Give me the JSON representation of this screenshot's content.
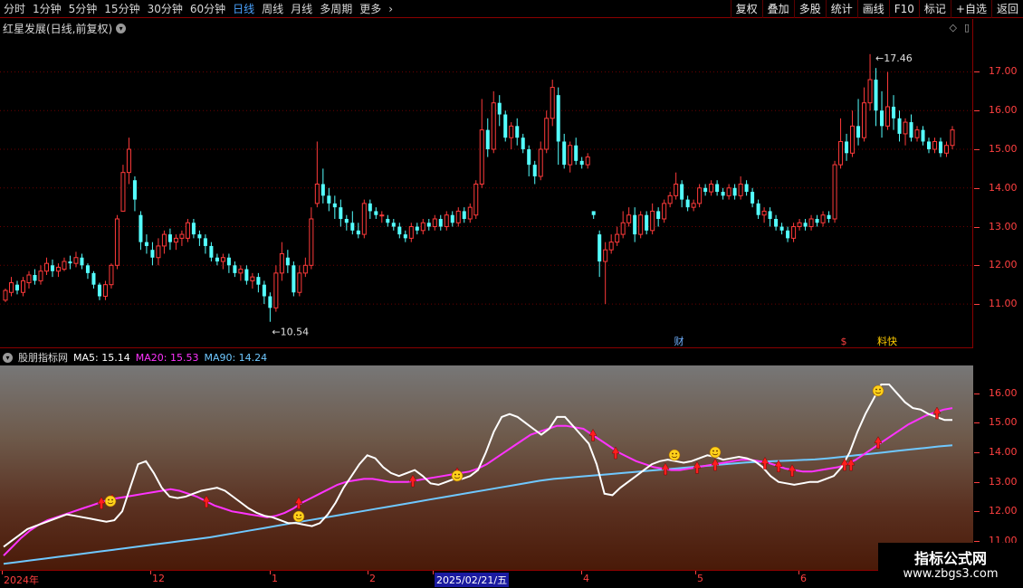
{
  "toolbar": {
    "periods": [
      "分时",
      "1分钟",
      "5分钟",
      "15分钟",
      "30分钟",
      "60分钟",
      "日线",
      "周线",
      "月线",
      "多周期",
      "更多"
    ],
    "active_period": "日线",
    "buttons": [
      "复权",
      "叠加",
      "多股",
      "统计",
      "画线",
      "F10",
      "标记",
      "+自选",
      "返回"
    ]
  },
  "main": {
    "title": "红星发展(日线,前复权)",
    "high_label": "17.46",
    "low_label": "10.54",
    "markers": [
      "财",
      "$",
      "料快"
    ],
    "ticks": [
      "17.00",
      "16.00",
      "15.00",
      "14.00",
      "13.00",
      "12.00",
      "11.00"
    ]
  },
  "indicator": {
    "name": "股朋指标网",
    "ma5_label": "MA5:",
    "ma5_value": "15.14",
    "ma20_label": "MA20:",
    "ma20_value": "15.53",
    "ma90_label": "MA90:",
    "ma90_value": "14.24",
    "ticks": [
      "16.00",
      "15.00",
      "14.00",
      "13.00",
      "12.00",
      "11.00"
    ]
  },
  "date_axis": {
    "labels": [
      "2024年",
      "12",
      "1",
      "2",
      "2025/02/21/五",
      "4",
      "5",
      "6"
    ],
    "selected": "2025/02/21/五"
  },
  "watermark": {
    "line1": "指标公式网",
    "line2": "www.zbgs3.com"
  },
  "colors": {
    "up": "#ff3a3a",
    "down": "#54ffff",
    "ma5": "#ffffff",
    "ma20": "#ff33ff",
    "ma90": "#6fc8ff",
    "axis": "#ff4040"
  },
  "chart_data": {
    "type": "candlestick",
    "price_range": [
      10.3,
      17.9
    ],
    "candles": [
      [
        11.1,
        11.35,
        11.4,
        11.05
      ],
      [
        11.3,
        11.55,
        11.7,
        11.2
      ],
      [
        11.5,
        11.35,
        11.6,
        11.25
      ],
      [
        11.3,
        11.6,
        11.7,
        11.2
      ],
      [
        11.55,
        11.75,
        11.85,
        11.4
      ],
      [
        11.75,
        11.6,
        11.9,
        11.5
      ],
      [
        11.6,
        11.85,
        12.0,
        11.5
      ],
      [
        11.85,
        12.05,
        12.2,
        11.75
      ],
      [
        12.0,
        11.85,
        12.15,
        11.7
      ],
      [
        11.85,
        11.95,
        12.05,
        11.7
      ],
      [
        11.9,
        12.1,
        12.2,
        11.85
      ],
      [
        12.1,
        12.05,
        12.25,
        11.9
      ],
      [
        12.05,
        12.2,
        12.35,
        11.95
      ],
      [
        12.2,
        12.0,
        12.3,
        11.9
      ],
      [
        12.0,
        11.8,
        12.05,
        11.65
      ],
      [
        11.8,
        11.5,
        11.85,
        11.4
      ],
      [
        11.5,
        11.2,
        11.55,
        11.1
      ],
      [
        11.2,
        11.5,
        11.6,
        11.1
      ],
      [
        11.5,
        12.0,
        12.05,
        11.4
      ],
      [
        12.0,
        13.2,
        13.3,
        11.9
      ],
      [
        13.4,
        14.4,
        14.6,
        13.8
      ],
      [
        14.4,
        15.0,
        15.3,
        14.1
      ],
      [
        14.2,
        13.7,
        14.3,
        13.4
      ],
      [
        13.3,
        12.6,
        13.4,
        12.4
      ],
      [
        12.6,
        12.5,
        12.8,
        12.3
      ],
      [
        12.4,
        12.2,
        12.6,
        12.0
      ],
      [
        12.2,
        12.5,
        12.7,
        12.0
      ],
      [
        12.5,
        12.8,
        12.9,
        12.3
      ],
      [
        12.8,
        12.6,
        12.95,
        12.4
      ],
      [
        12.6,
        12.7,
        12.8,
        12.4
      ],
      [
        12.7,
        12.8,
        12.9,
        12.5
      ],
      [
        12.7,
        13.1,
        13.2,
        12.6
      ],
      [
        13.1,
        12.8,
        13.2,
        12.7
      ],
      [
        12.8,
        12.7,
        12.9,
        12.5
      ],
      [
        12.7,
        12.5,
        12.8,
        12.3
      ],
      [
        12.5,
        12.2,
        12.6,
        12.1
      ],
      [
        12.2,
        12.1,
        12.3,
        12.0
      ],
      [
        12.1,
        12.2,
        12.3,
        11.9
      ],
      [
        12.2,
        12.0,
        12.3,
        11.8
      ],
      [
        12.0,
        11.8,
        12.1,
        11.7
      ],
      [
        11.8,
        11.9,
        12.0,
        11.6
      ],
      [
        11.9,
        11.6,
        12.0,
        11.5
      ],
      [
        11.6,
        11.7,
        11.8,
        11.4
      ],
      [
        11.7,
        11.5,
        11.8,
        11.3
      ],
      [
        11.5,
        11.2,
        11.6,
        11.0
      ],
      [
        11.2,
        10.9,
        11.3,
        10.54
      ],
      [
        10.9,
        11.8,
        12.0,
        10.8
      ],
      [
        11.8,
        12.3,
        12.6,
        11.6
      ],
      [
        12.2,
        12.0,
        12.4,
        11.8
      ],
      [
        12.0,
        11.3,
        12.1,
        11.2
      ],
      [
        11.3,
        11.8,
        12.0,
        11.2
      ],
      [
        11.8,
        12.0,
        12.2,
        11.7
      ],
      [
        12.0,
        13.2,
        13.5,
        11.9
      ],
      [
        13.6,
        14.1,
        15.2,
        13.5
      ],
      [
        14.1,
        13.8,
        14.5,
        13.6
      ],
      [
        13.8,
        13.6,
        14.0,
        13.4
      ],
      [
        13.6,
        13.5,
        13.8,
        13.2
      ],
      [
        13.5,
        13.2,
        13.7,
        13.0
      ],
      [
        13.2,
        13.1,
        13.3,
        12.9
      ],
      [
        13.1,
        12.9,
        13.4,
        12.8
      ],
      [
        12.9,
        12.8,
        13.1,
        12.7
      ],
      [
        12.8,
        13.6,
        13.7,
        12.7
      ],
      [
        13.6,
        13.4,
        13.7,
        13.2
      ],
      [
        13.4,
        13.3,
        13.5,
        13.2
      ],
      [
        13.3,
        13.3,
        13.4,
        13.1
      ],
      [
        13.2,
        13.1,
        13.3,
        13.0
      ],
      [
        13.1,
        13.0,
        13.2,
        12.9
      ],
      [
        13.0,
        12.8,
        13.1,
        12.7
      ],
      [
        12.8,
        12.7,
        12.9,
        12.6
      ],
      [
        12.7,
        13.0,
        13.1,
        12.6
      ],
      [
        13.0,
        12.9,
        13.1,
        12.8
      ],
      [
        12.9,
        13.1,
        13.2,
        12.8
      ],
      [
        13.1,
        13.0,
        13.2,
        12.9
      ],
      [
        13.0,
        13.2,
        13.3,
        12.9
      ],
      [
        13.2,
        13.0,
        13.3,
        12.9
      ],
      [
        13.0,
        13.3,
        13.4,
        12.9
      ],
      [
        13.3,
        13.1,
        13.4,
        13.0
      ],
      [
        13.1,
        13.4,
        13.5,
        13.0
      ],
      [
        13.4,
        13.2,
        13.5,
        13.1
      ],
      [
        13.2,
        13.5,
        13.6,
        13.1
      ],
      [
        13.3,
        14.1,
        14.2,
        13.2
      ],
      [
        14.1,
        15.5,
        16.3,
        14.0
      ],
      [
        15.5,
        15.0,
        15.8,
        14.8
      ],
      [
        15.0,
        16.2,
        16.5,
        14.9
      ],
      [
        16.2,
        15.9,
        16.4,
        15.6
      ],
      [
        15.9,
        15.3,
        16.0,
        15.2
      ],
      [
        15.3,
        15.6,
        15.7,
        15.0
      ],
      [
        15.6,
        15.3,
        15.8,
        15.1
      ],
      [
        15.3,
        15.0,
        15.4,
        14.9
      ],
      [
        15.0,
        14.6,
        15.1,
        14.3
      ],
      [
        14.6,
        14.3,
        14.7,
        14.1
      ],
      [
        14.3,
        15.0,
        15.2,
        14.2
      ],
      [
        15.0,
        15.8,
        16.0,
        14.9
      ],
      [
        15.8,
        16.6,
        16.8,
        15.6
      ],
      [
        16.4,
        15.2,
        16.6,
        14.6
      ],
      [
        15.2,
        14.6,
        15.4,
        14.5
      ],
      [
        14.6,
        15.1,
        15.2,
        14.4
      ],
      [
        15.1,
        14.7,
        15.3,
        14.6
      ],
      [
        14.7,
        14.6,
        14.8,
        14.5
      ],
      [
        14.6,
        14.8,
        14.9,
        14.5
      ],
      [
        13.4,
        13.3,
        13.4,
        13.2
      ],
      [
        12.8,
        12.1,
        12.9,
        11.7
      ],
      [
        12.1,
        12.4,
        12.6,
        11.0
      ],
      [
        12.4,
        12.6,
        12.8,
        12.3
      ],
      [
        12.6,
        12.8,
        13.0,
        12.5
      ],
      [
        12.8,
        13.1,
        13.4,
        12.7
      ],
      [
        13.1,
        13.3,
        13.5,
        13.0
      ],
      [
        13.3,
        12.8,
        13.5,
        12.6
      ],
      [
        12.8,
        13.3,
        13.4,
        12.7
      ],
      [
        13.3,
        12.9,
        13.4,
        12.8
      ],
      [
        12.9,
        13.4,
        13.6,
        12.8
      ],
      [
        13.4,
        13.2,
        13.5,
        13.0
      ],
      [
        13.2,
        13.6,
        13.7,
        13.1
      ],
      [
        13.6,
        13.8,
        13.9,
        13.5
      ],
      [
        13.8,
        14.1,
        14.4,
        13.7
      ],
      [
        14.1,
        13.7,
        14.2,
        13.5
      ],
      [
        13.7,
        13.5,
        13.8,
        13.4
      ],
      [
        13.5,
        13.6,
        13.7,
        13.4
      ],
      [
        13.6,
        14.0,
        14.1,
        13.5
      ],
      [
        14.0,
        13.9,
        14.1,
        13.8
      ],
      [
        13.9,
        14.1,
        14.2,
        13.8
      ],
      [
        14.1,
        13.9,
        14.2,
        13.8
      ],
      [
        13.9,
        13.8,
        14.0,
        13.7
      ],
      [
        13.8,
        14.0,
        14.1,
        13.7
      ],
      [
        14.0,
        13.8,
        14.1,
        13.7
      ],
      [
        13.8,
        14.1,
        14.3,
        13.7
      ],
      [
        14.1,
        13.9,
        14.2,
        13.8
      ],
      [
        13.9,
        13.6,
        14.0,
        13.5
      ],
      [
        13.6,
        13.3,
        13.7,
        13.2
      ],
      [
        13.3,
        13.4,
        13.5,
        13.1
      ],
      [
        13.4,
        13.2,
        13.5,
        13.0
      ],
      [
        13.2,
        13.0,
        13.3,
        12.9
      ],
      [
        13.0,
        12.9,
        13.1,
        12.8
      ],
      [
        12.9,
        12.7,
        13.0,
        12.6
      ],
      [
        12.7,
        13.0,
        13.1,
        12.6
      ],
      [
        13.0,
        13.1,
        13.2,
        12.9
      ],
      [
        13.1,
        13.0,
        13.2,
        12.9
      ],
      [
        13.0,
        13.2,
        13.3,
        12.9
      ],
      [
        13.2,
        13.1,
        13.3,
        13.0
      ],
      [
        13.1,
        13.3,
        13.4,
        13.0
      ],
      [
        13.3,
        13.2,
        13.4,
        13.1
      ],
      [
        13.2,
        14.6,
        14.7,
        13.1
      ],
      [
        14.6,
        15.2,
        15.8,
        14.5
      ],
      [
        15.2,
        14.9,
        15.4,
        14.7
      ],
      [
        14.9,
        15.6,
        16.0,
        14.8
      ],
      [
        15.6,
        15.3,
        16.3,
        15.1
      ],
      [
        15.3,
        16.2,
        16.6,
        15.2
      ],
      [
        16.2,
        16.8,
        17.46,
        16.0
      ],
      [
        16.8,
        16.0,
        17.1,
        15.6
      ],
      [
        16.0,
        15.6,
        16.5,
        15.3
      ],
      [
        15.6,
        16.1,
        17.0,
        15.5
      ],
      [
        16.1,
        15.8,
        16.4,
        15.5
      ],
      [
        15.8,
        15.4,
        16.0,
        15.2
      ],
      [
        15.4,
        15.7,
        15.8,
        15.1
      ],
      [
        15.7,
        15.3,
        15.9,
        15.2
      ],
      [
        15.3,
        15.5,
        15.6,
        15.2
      ],
      [
        15.5,
        15.2,
        15.6,
        15.1
      ],
      [
        15.2,
        15.0,
        15.3,
        14.9
      ],
      [
        15.0,
        15.2,
        15.3,
        14.9
      ],
      [
        15.2,
        14.9,
        15.3,
        14.8
      ],
      [
        14.9,
        15.1,
        15.2,
        14.8
      ],
      [
        15.1,
        15.5,
        15.6,
        15.0
      ]
    ],
    "ma5": [
      10.8,
      11.0,
      11.2,
      11.4,
      11.5,
      11.6,
      11.7,
      11.8,
      11.9,
      11.85,
      11.8,
      11.75,
      11.7,
      11.65,
      11.7,
      12.0,
      12.8,
      13.6,
      13.7,
      13.3,
      12.8,
      12.5,
      12.45,
      12.5,
      12.6,
      12.7,
      12.75,
      12.8,
      12.7,
      12.5,
      12.3,
      12.1,
      11.95,
      11.85,
      11.8,
      11.7,
      11.6,
      11.6,
      11.55,
      11.5,
      11.6,
      11.9,
      12.3,
      12.8,
      13.2,
      13.6,
      13.9,
      13.8,
      13.5,
      13.3,
      13.2,
      13.3,
      13.4,
      13.2,
      12.95,
      12.9,
      13.0,
      13.1,
      13.1,
      13.2,
      13.4,
      14.0,
      14.7,
      15.2,
      15.3,
      15.2,
      15.0,
      14.8,
      14.6,
      14.8,
      15.2,
      15.2,
      14.9,
      14.6,
      14.3,
      13.6,
      12.6,
      12.55,
      12.8,
      13.0,
      13.2,
      13.4,
      13.6,
      13.7,
      13.75,
      13.7,
      13.65,
      13.7,
      13.8,
      13.9,
      13.85,
      13.75,
      13.8,
      13.85,
      13.8,
      13.7,
      13.5,
      13.2,
      13.0,
      12.95,
      12.9,
      12.95,
      13.0,
      13.0,
      13.1,
      13.2,
      13.5,
      14.0,
      14.7,
      15.3,
      15.8,
      16.3,
      16.3,
      16.0,
      15.7,
      15.5,
      15.45,
      15.3,
      15.2,
      15.1,
      15.1
    ],
    "ma20": [
      10.5,
      10.8,
      11.1,
      11.35,
      11.55,
      11.7,
      11.8,
      11.9,
      12.0,
      12.1,
      12.2,
      12.3,
      12.4,
      12.45,
      12.5,
      12.55,
      12.6,
      12.65,
      12.7,
      12.75,
      12.7,
      12.6,
      12.5,
      12.35,
      12.2,
      12.1,
      12.0,
      11.95,
      11.9,
      11.85,
      11.8,
      11.85,
      11.95,
      12.1,
      12.3,
      12.45,
      12.6,
      12.75,
      12.9,
      13.0,
      13.05,
      13.1,
      13.1,
      13.05,
      13.0,
      13.0,
      13.0,
      13.05,
      13.1,
      13.15,
      13.2,
      13.25,
      13.3,
      13.35,
      13.45,
      13.6,
      13.8,
      14.0,
      14.2,
      14.4,
      14.6,
      14.7,
      14.8,
      14.9,
      14.9,
      14.85,
      14.8,
      14.6,
      14.4,
      14.2,
      14.0,
      13.85,
      13.7,
      13.6,
      13.5,
      13.45,
      13.4,
      13.4,
      13.45,
      13.5,
      13.55,
      13.6,
      13.65,
      13.7,
      13.75,
      13.75,
      13.7,
      13.65,
      13.55,
      13.45,
      13.4,
      13.35,
      13.35,
      13.4,
      13.45,
      13.5,
      13.6,
      13.75,
      13.95,
      14.15,
      14.35,
      14.55,
      14.75,
      14.95,
      15.1,
      15.25,
      15.35,
      15.45,
      15.5
    ],
    "ma90": [
      10.22,
      10.28,
      10.34,
      10.4,
      10.46,
      10.52,
      10.58,
      10.64,
      10.7,
      10.76,
      10.82,
      10.88,
      10.94,
      11.0,
      11.06,
      11.12,
      11.2,
      11.28,
      11.36,
      11.44,
      11.52,
      11.6,
      11.68,
      11.76,
      11.84,
      11.92,
      12.0,
      12.08,
      12.16,
      12.24,
      12.32,
      12.4,
      12.48,
      12.56,
      12.64,
      12.72,
      12.8,
      12.88,
      12.96,
      13.04,
      13.1,
      13.14,
      13.18,
      13.22,
      13.26,
      13.3,
      13.34,
      13.38,
      13.42,
      13.46,
      13.5,
      13.54,
      13.58,
      13.62,
      13.66,
      13.68,
      13.7,
      13.72,
      13.74,
      13.76,
      13.8,
      13.85,
      13.9,
      13.95,
      14.0,
      14.05,
      14.1,
      14.15,
      14.2,
      14.24
    ]
  }
}
